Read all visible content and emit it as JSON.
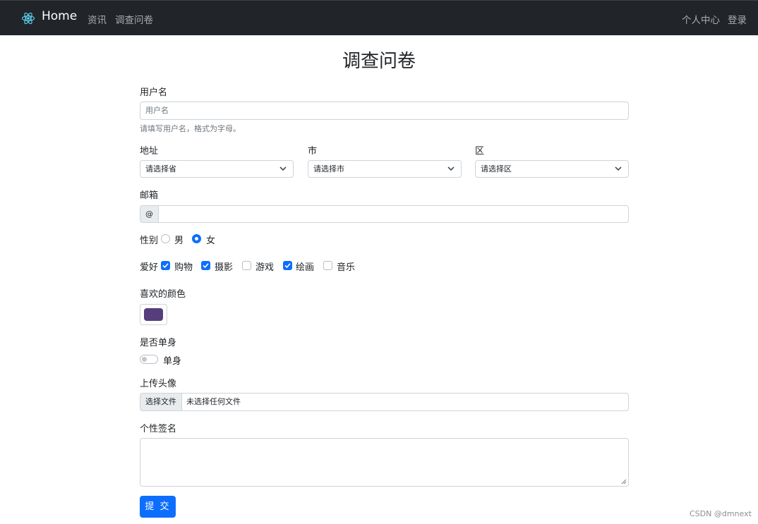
{
  "navbar": {
    "brand": "Home",
    "links": [
      "资讯",
      "调查问卷"
    ],
    "right_links": [
      "个人中心",
      "登录"
    ],
    "brand_icon": "react-atom-icon"
  },
  "form": {
    "title": "调查问卷",
    "username": {
      "label": "用户名",
      "placeholder": "用户名",
      "help": "请填写用户名，格式为字母。"
    },
    "address": {
      "province_label": "地址",
      "province_value": "请选择省",
      "city_label": "市",
      "city_value": "请选择市",
      "district_label": "区",
      "district_value": "请选择区"
    },
    "email": {
      "label": "邮箱",
      "prefix": "@",
      "value": ""
    },
    "gender": {
      "label": "性别",
      "options": [
        {
          "label": "男",
          "checked": false
        },
        {
          "label": "女",
          "checked": true
        }
      ]
    },
    "hobbies": {
      "label": "爱好",
      "options": [
        {
          "label": "购物",
          "checked": true
        },
        {
          "label": "摄影",
          "checked": true
        },
        {
          "label": "游戏",
          "checked": false
        },
        {
          "label": "绘画",
          "checked": true
        },
        {
          "label": "音乐",
          "checked": false
        }
      ]
    },
    "color": {
      "label": "喜欢的颜色",
      "value": "#563d7c"
    },
    "single": {
      "label": "是否单身",
      "switch_label": "单身",
      "on": false
    },
    "avatar": {
      "label": "上传头像",
      "button": "选择文件",
      "file_text": "未选择任何文件"
    },
    "signature": {
      "label": "个性签名",
      "value": ""
    },
    "submit": "提 交"
  },
  "watermark": "CSDN @dmnext",
  "colors": {
    "navbar_bg": "#212529",
    "primary": "#0d6efd"
  }
}
